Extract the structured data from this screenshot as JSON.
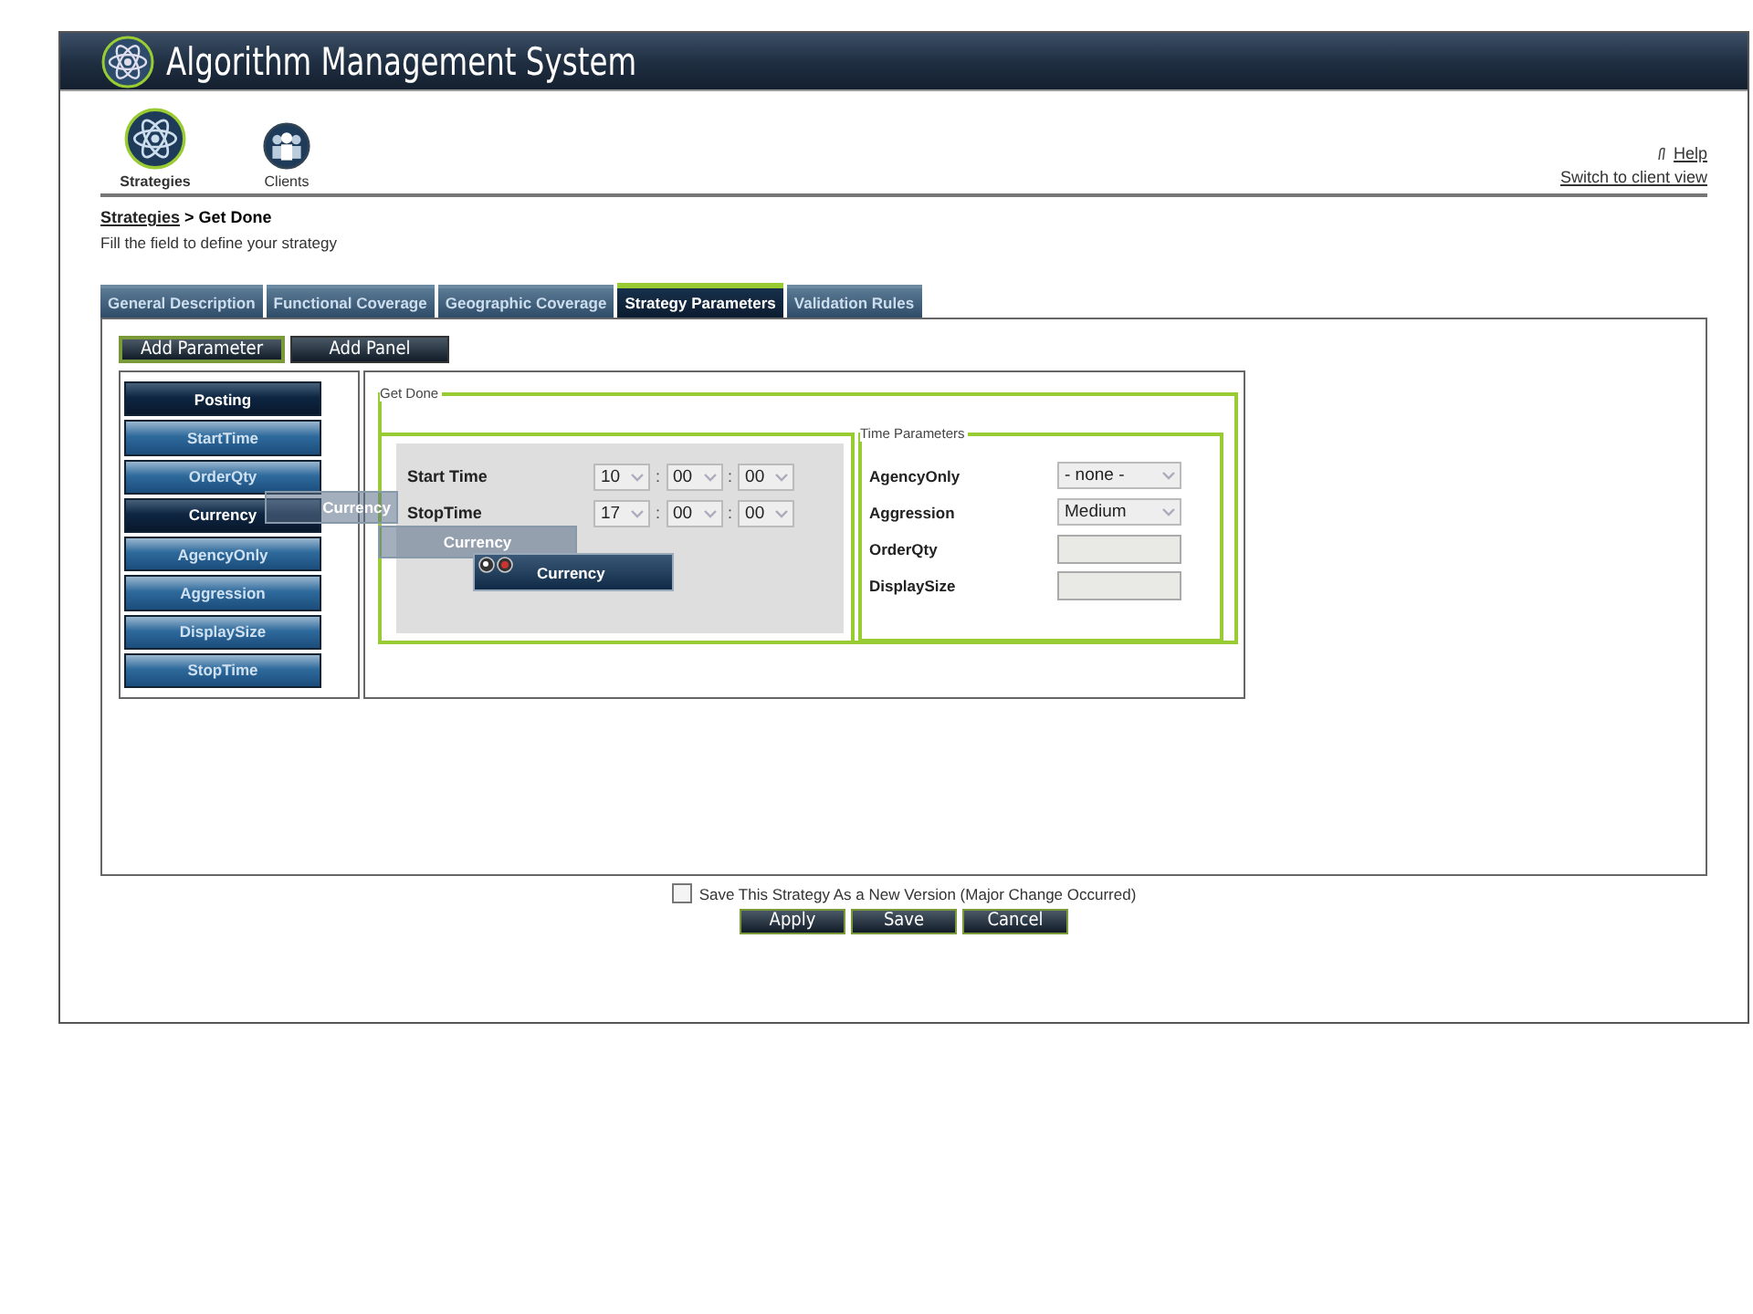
{
  "window": {
    "title": "Algorithm Management System"
  },
  "nav": [
    {
      "label": "Strategies",
      "selected": true,
      "kind": "atom"
    },
    {
      "label": "Clients",
      "selected": false,
      "kind": "person"
    }
  ],
  "links": {
    "help": "Help",
    "switch": "Switch to client view"
  },
  "breadcrumb": {
    "link": "Strategies",
    "current": "> Get Done"
  },
  "instruction": "Fill the field to define your strategy",
  "tabs": [
    {
      "label": "General Description",
      "selected": false
    },
    {
      "label": "Functional Coverage",
      "selected": false
    },
    {
      "label": "Geographic Coverage",
      "selected": false
    },
    {
      "label": "Strategy Parameters",
      "selected": true
    },
    {
      "label": "Validation Rules",
      "selected": false
    }
  ],
  "toolbar": [
    {
      "label": "Add Parameter",
      "selected": true
    },
    {
      "label": "Add Panel",
      "selected": false
    }
  ],
  "palette": [
    {
      "label": "Posting",
      "selected": true
    },
    {
      "label": "StartTime",
      "selected": false
    },
    {
      "label": "OrderQty",
      "selected": false
    },
    {
      "label": "Currency",
      "selected": true
    },
    {
      "label": "AgencyOnly",
      "selected": false
    },
    {
      "label": "Aggression",
      "selected": false
    },
    {
      "label": "DisplaySize",
      "selected": false
    },
    {
      "label": "StopTime",
      "selected": false
    }
  ],
  "panel": {
    "title": "Get Done",
    "time_rows": [
      {
        "label": "Start Time",
        "values": [
          "10",
          "00",
          "00"
        ]
      },
      {
        "label": "StopTime",
        "values": [
          "17",
          "00",
          "00"
        ]
      }
    ],
    "separator": ":",
    "time_parameters": {
      "title": "Time Parameters",
      "fields": [
        {
          "label": "AgencyOnly",
          "kind": "select",
          "value": "- none -"
        },
        {
          "label": "Aggression",
          "kind": "select",
          "value": "Medium"
        },
        {
          "label": "OrderQty",
          "kind": "text"
        },
        {
          "label": "DisplaySize",
          "kind": "text"
        }
      ]
    }
  },
  "drag_ghosts": [
    {
      "label": "Currency",
      "kind": "faded"
    },
    {
      "label": "Currency",
      "kind": "faded"
    },
    {
      "label": "Currency",
      "kind": "active"
    }
  ],
  "new_version": {
    "label": "Save This Strategy As a New Version (Major Change Occurred)",
    "checked": false
  },
  "buttons": [
    "Apply",
    "Save",
    "Cancel"
  ]
}
